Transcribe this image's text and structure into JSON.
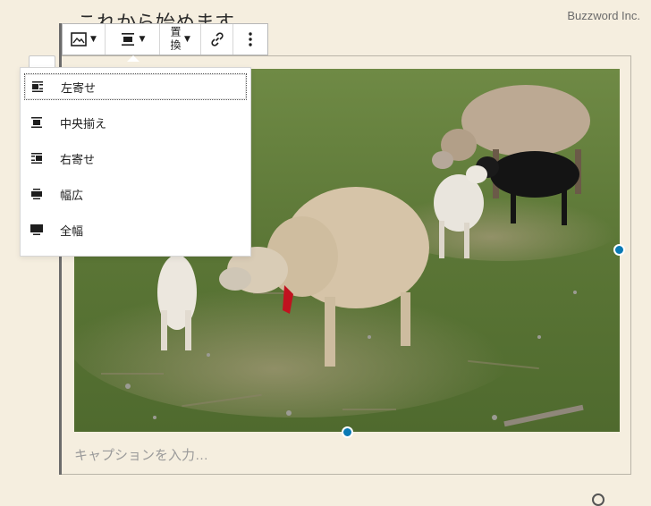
{
  "branding": {
    "watermark": "Buzzword Inc."
  },
  "editor": {
    "heading_partial": "これから始めます",
    "caption_placeholder": "キャプションを入力…"
  },
  "toolbar": {
    "replace_label": "置換",
    "buttons": [
      {
        "name": "image-block-button",
        "icon": "image-icon",
        "has_caret": true
      },
      {
        "name": "align-button",
        "icon": "align-center-icon",
        "has_caret": true
      },
      {
        "name": "replace-button",
        "icon": "",
        "has_caret": true
      },
      {
        "name": "link-button",
        "icon": "link-icon",
        "has_caret": false
      },
      {
        "name": "more-options-button",
        "icon": "vertical-ellipsis-icon",
        "has_caret": false
      }
    ]
  },
  "align_menu": {
    "selected": "左寄せ",
    "items": [
      {
        "label": "左寄せ",
        "icon": "align-left-icon"
      },
      {
        "label": "中央揃え",
        "icon": "align-center-icon"
      },
      {
        "label": "右寄せ",
        "icon": "align-right-icon"
      },
      {
        "label": "幅広",
        "icon": "align-wide-icon"
      },
      {
        "label": "全幅",
        "icon": "align-full-icon"
      }
    ]
  },
  "colors": {
    "background": "#f5eedf",
    "handle": "#0a7ab5",
    "toolbar_bg": "#ffffff",
    "block_border": "#6b6b6b",
    "grass": "#5f7a3a",
    "wool": "#d6c4a8"
  }
}
